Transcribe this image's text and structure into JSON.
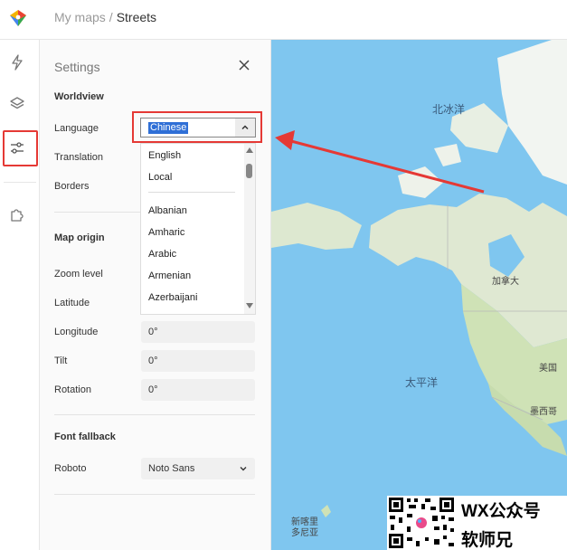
{
  "breadcrumb": {
    "parent": "My maps",
    "separator": "/",
    "current": "Streets"
  },
  "rail": {
    "items": [
      {
        "name": "bolt-icon"
      },
      {
        "name": "layers-icon"
      },
      {
        "name": "sliders-icon",
        "selected": true
      },
      {
        "name": "puzzle-icon"
      }
    ]
  },
  "settings": {
    "title": "Settings",
    "worldview": {
      "heading": "Worldview",
      "language_label": "Language",
      "language_value": "Chinese",
      "translation_label": "Translation",
      "borders_label": "Borders",
      "language_options": [
        "English",
        "Local",
        "Albanian",
        "Amharic",
        "Arabic",
        "Armenian",
        "Azerbaijani"
      ]
    },
    "map_origin": {
      "heading": "Map origin",
      "zoom_label": "Zoom level",
      "latitude_label": "Latitude",
      "longitude_label": "Longitude",
      "longitude_value": "0°",
      "tilt_label": "Tilt",
      "tilt_value": "0°",
      "rotation_label": "Rotation",
      "rotation_value": "0°"
    },
    "font_fallback": {
      "heading": "Font fallback",
      "font_label": "Roboto",
      "font_value": "Noto Sans"
    }
  },
  "map": {
    "labels": {
      "arctic": "北冰洋",
      "canada": "加拿大",
      "pacific": "太平洋",
      "usa": "美国",
      "mexico": "墨西哥",
      "new_caledonia": "新喀里\n多尼亚"
    },
    "colors": {
      "ocean": "#7fc6ef",
      "land": "#cfe2b6",
      "ice": "#f4f6f4"
    }
  },
  "watermark": {
    "line1": "WX公众号",
    "line2": "软师兄"
  },
  "colors": {
    "highlight": "#e53935",
    "selection": "#2f6fd6"
  }
}
